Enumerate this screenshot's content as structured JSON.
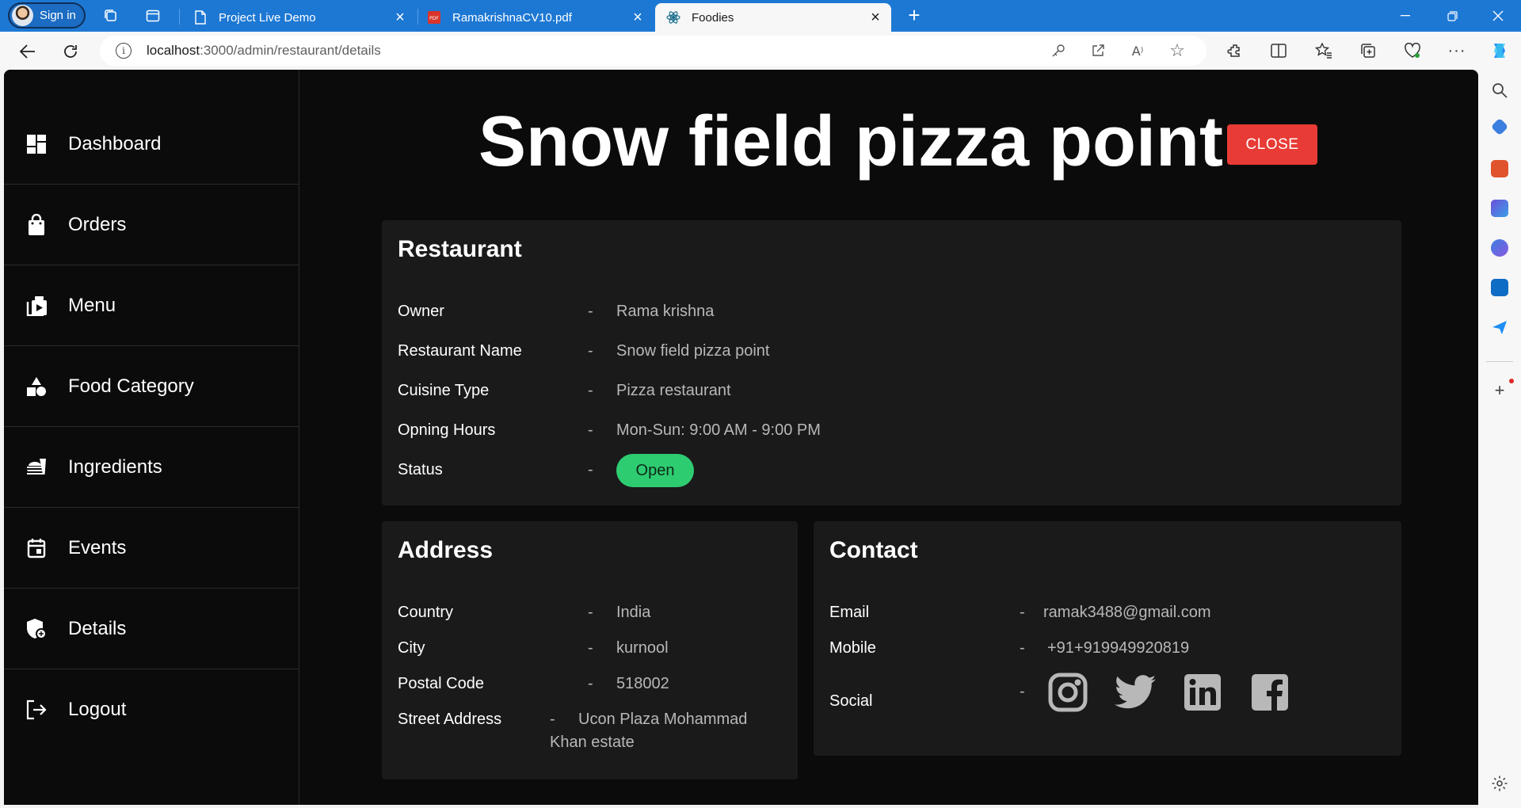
{
  "browser": {
    "profile_label": "Sign in",
    "tabs": [
      {
        "title": "Project Live Demo",
        "active": false
      },
      {
        "title": "RamakrishnaCV10.pdf",
        "active": false
      },
      {
        "title": "Foodies",
        "active": true
      }
    ],
    "url_host": "localhost",
    "url_path": ":3000/admin/restaurant/details"
  },
  "sidebar": {
    "items": [
      {
        "label": "Dashboard",
        "icon": "dashboard-icon"
      },
      {
        "label": "Orders",
        "icon": "shopping-bag-icon"
      },
      {
        "label": "Menu",
        "icon": "menu-icon"
      },
      {
        "label": "Food Category",
        "icon": "category-icon"
      },
      {
        "label": "Ingredients",
        "icon": "ingredients-icon"
      },
      {
        "label": "Events",
        "icon": "calendar-icon"
      },
      {
        "label": "Details",
        "icon": "details-icon"
      },
      {
        "label": "Logout",
        "icon": "logout-icon"
      }
    ]
  },
  "header": {
    "title": "Snow field pizza point",
    "close_label": "CLOSE"
  },
  "restaurant": {
    "heading": "Restaurant",
    "owner_label": "Owner",
    "owner": "Rama krishna",
    "name_label": "Restaurant Name",
    "name": "Snow field pizza point",
    "cuisine_label": "Cuisine Type",
    "cuisine": "Pizza restaurant",
    "hours_label": "Opning Hours",
    "hours": "Mon-Sun: 9:00 AM - 9:00 PM",
    "status_label": "Status",
    "status": "Open"
  },
  "address": {
    "heading": "Address",
    "country_label": "Country",
    "country": "India",
    "city_label": "City",
    "city": "kurnool",
    "postal_label": "Postal Code",
    "postal": "518002",
    "street_label": "Street Address",
    "street_line1": "Ucon Plaza Mohammad",
    "street_line2": "Khan estate"
  },
  "contact": {
    "heading": "Contact",
    "email_label": "Email",
    "email": "ramak3488@gmail.com",
    "mobile_label": "Mobile",
    "mobile": "+91+919949920819",
    "social_label": "Social",
    "social": [
      "instagram-icon",
      "twitter-icon",
      "linkedin-icon",
      "facebook-icon"
    ]
  },
  "separator": "-",
  "colors": {
    "close_button": "#e83b35",
    "status_open": "#2ecc71",
    "background": "#0b0b0b",
    "card": "#1a1a1a",
    "browser_accent": "#1d78d4"
  }
}
